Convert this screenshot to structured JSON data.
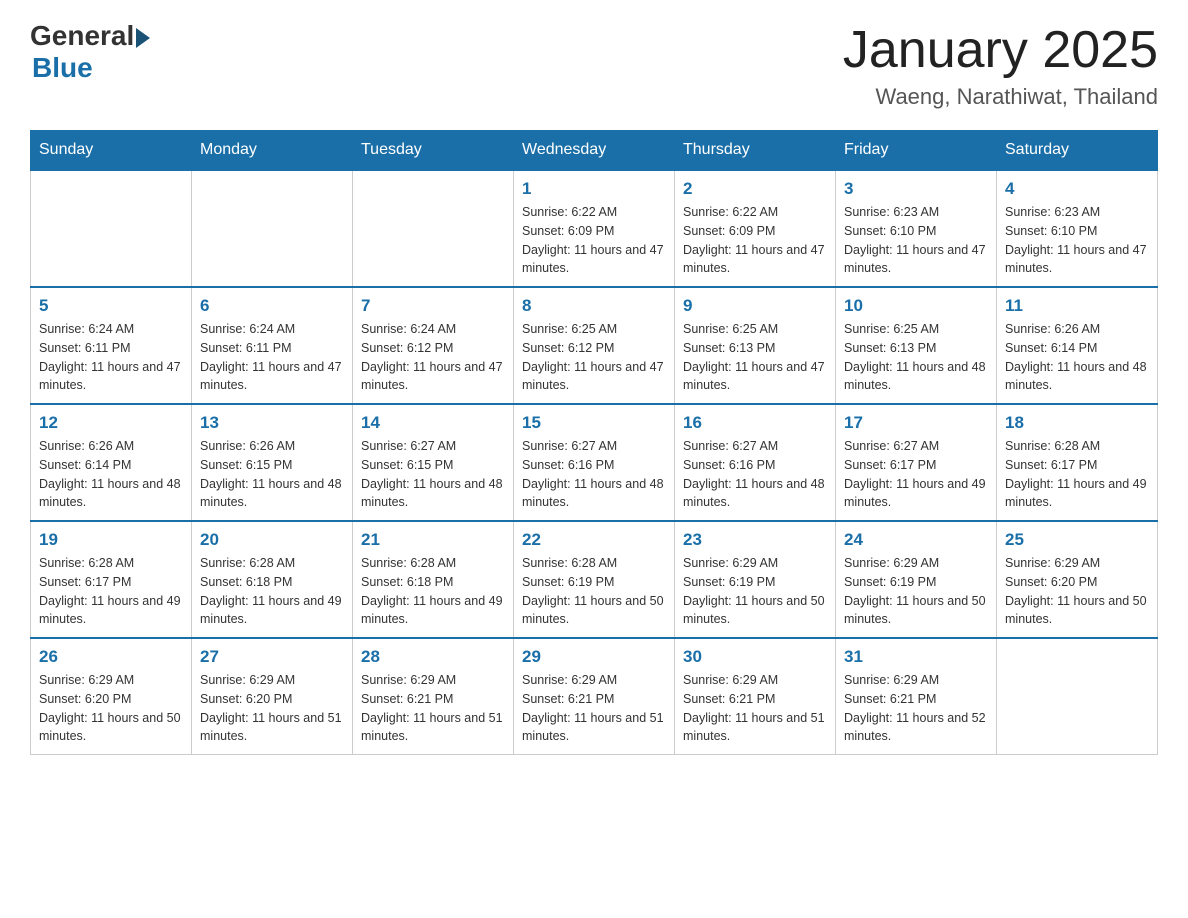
{
  "header": {
    "logo_general": "General",
    "logo_blue": "Blue",
    "month_title": "January 2025",
    "location": "Waeng, Narathiwat, Thailand"
  },
  "days_of_week": [
    "Sunday",
    "Monday",
    "Tuesday",
    "Wednesday",
    "Thursday",
    "Friday",
    "Saturday"
  ],
  "weeks": [
    [
      {
        "day": "",
        "info": ""
      },
      {
        "day": "",
        "info": ""
      },
      {
        "day": "",
        "info": ""
      },
      {
        "day": "1",
        "info": "Sunrise: 6:22 AM\nSunset: 6:09 PM\nDaylight: 11 hours and 47 minutes."
      },
      {
        "day": "2",
        "info": "Sunrise: 6:22 AM\nSunset: 6:09 PM\nDaylight: 11 hours and 47 minutes."
      },
      {
        "day": "3",
        "info": "Sunrise: 6:23 AM\nSunset: 6:10 PM\nDaylight: 11 hours and 47 minutes."
      },
      {
        "day": "4",
        "info": "Sunrise: 6:23 AM\nSunset: 6:10 PM\nDaylight: 11 hours and 47 minutes."
      }
    ],
    [
      {
        "day": "5",
        "info": "Sunrise: 6:24 AM\nSunset: 6:11 PM\nDaylight: 11 hours and 47 minutes."
      },
      {
        "day": "6",
        "info": "Sunrise: 6:24 AM\nSunset: 6:11 PM\nDaylight: 11 hours and 47 minutes."
      },
      {
        "day": "7",
        "info": "Sunrise: 6:24 AM\nSunset: 6:12 PM\nDaylight: 11 hours and 47 minutes."
      },
      {
        "day": "8",
        "info": "Sunrise: 6:25 AM\nSunset: 6:12 PM\nDaylight: 11 hours and 47 minutes."
      },
      {
        "day": "9",
        "info": "Sunrise: 6:25 AM\nSunset: 6:13 PM\nDaylight: 11 hours and 47 minutes."
      },
      {
        "day": "10",
        "info": "Sunrise: 6:25 AM\nSunset: 6:13 PM\nDaylight: 11 hours and 48 minutes."
      },
      {
        "day": "11",
        "info": "Sunrise: 6:26 AM\nSunset: 6:14 PM\nDaylight: 11 hours and 48 minutes."
      }
    ],
    [
      {
        "day": "12",
        "info": "Sunrise: 6:26 AM\nSunset: 6:14 PM\nDaylight: 11 hours and 48 minutes."
      },
      {
        "day": "13",
        "info": "Sunrise: 6:26 AM\nSunset: 6:15 PM\nDaylight: 11 hours and 48 minutes."
      },
      {
        "day": "14",
        "info": "Sunrise: 6:27 AM\nSunset: 6:15 PM\nDaylight: 11 hours and 48 minutes."
      },
      {
        "day": "15",
        "info": "Sunrise: 6:27 AM\nSunset: 6:16 PM\nDaylight: 11 hours and 48 minutes."
      },
      {
        "day": "16",
        "info": "Sunrise: 6:27 AM\nSunset: 6:16 PM\nDaylight: 11 hours and 48 minutes."
      },
      {
        "day": "17",
        "info": "Sunrise: 6:27 AM\nSunset: 6:17 PM\nDaylight: 11 hours and 49 minutes."
      },
      {
        "day": "18",
        "info": "Sunrise: 6:28 AM\nSunset: 6:17 PM\nDaylight: 11 hours and 49 minutes."
      }
    ],
    [
      {
        "day": "19",
        "info": "Sunrise: 6:28 AM\nSunset: 6:17 PM\nDaylight: 11 hours and 49 minutes."
      },
      {
        "day": "20",
        "info": "Sunrise: 6:28 AM\nSunset: 6:18 PM\nDaylight: 11 hours and 49 minutes."
      },
      {
        "day": "21",
        "info": "Sunrise: 6:28 AM\nSunset: 6:18 PM\nDaylight: 11 hours and 49 minutes."
      },
      {
        "day": "22",
        "info": "Sunrise: 6:28 AM\nSunset: 6:19 PM\nDaylight: 11 hours and 50 minutes."
      },
      {
        "day": "23",
        "info": "Sunrise: 6:29 AM\nSunset: 6:19 PM\nDaylight: 11 hours and 50 minutes."
      },
      {
        "day": "24",
        "info": "Sunrise: 6:29 AM\nSunset: 6:19 PM\nDaylight: 11 hours and 50 minutes."
      },
      {
        "day": "25",
        "info": "Sunrise: 6:29 AM\nSunset: 6:20 PM\nDaylight: 11 hours and 50 minutes."
      }
    ],
    [
      {
        "day": "26",
        "info": "Sunrise: 6:29 AM\nSunset: 6:20 PM\nDaylight: 11 hours and 50 minutes."
      },
      {
        "day": "27",
        "info": "Sunrise: 6:29 AM\nSunset: 6:20 PM\nDaylight: 11 hours and 51 minutes."
      },
      {
        "day": "28",
        "info": "Sunrise: 6:29 AM\nSunset: 6:21 PM\nDaylight: 11 hours and 51 minutes."
      },
      {
        "day": "29",
        "info": "Sunrise: 6:29 AM\nSunset: 6:21 PM\nDaylight: 11 hours and 51 minutes."
      },
      {
        "day": "30",
        "info": "Sunrise: 6:29 AM\nSunset: 6:21 PM\nDaylight: 11 hours and 51 minutes."
      },
      {
        "day": "31",
        "info": "Sunrise: 6:29 AM\nSunset: 6:21 PM\nDaylight: 11 hours and 52 minutes."
      },
      {
        "day": "",
        "info": ""
      }
    ]
  ]
}
